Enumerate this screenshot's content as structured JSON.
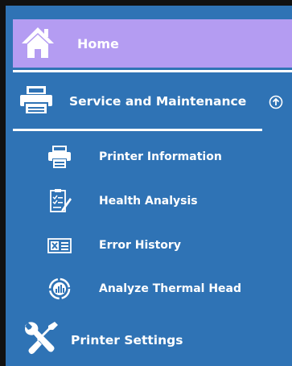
{
  "menu": {
    "home": {
      "label": "Home",
      "icon": "home-icon"
    },
    "service": {
      "label": "Service and Maintenance",
      "icon": "printer-icon",
      "toggle_icon": "collapse-up-icon",
      "items": [
        {
          "label": "Printer Information",
          "icon": "printer-icon"
        },
        {
          "label": "Health Analysis",
          "icon": "clipboard-checklist-icon"
        },
        {
          "label": "Error History",
          "icon": "error-log-icon"
        },
        {
          "label": "Analyze Thermal Head",
          "icon": "thermal-head-icon"
        }
      ]
    },
    "printer_settings": {
      "label": "Printer Settings",
      "icon": "wrench-screwdriver-icon"
    }
  },
  "colors": {
    "background": "#2f73b5",
    "home_highlight": "#b49cf2",
    "frame": "#111111",
    "text": "#ffffff"
  }
}
